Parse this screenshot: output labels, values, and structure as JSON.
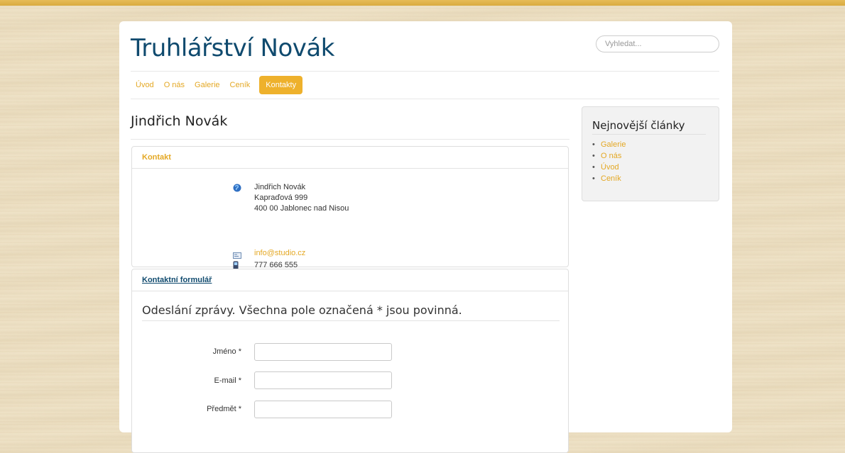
{
  "site": {
    "title": "Truhlářství Novák"
  },
  "search": {
    "placeholder": "Vyhledat..."
  },
  "nav": {
    "items": [
      "Úvod",
      "O nás",
      "Galerie",
      "Ceník",
      "Kontakty"
    ],
    "active": "Kontakty"
  },
  "page": {
    "heading": "Jindřich Novák"
  },
  "contact_panel": {
    "header": "Kontakt",
    "name": "Jindřich Novák",
    "street": "Kapraďová 999",
    "city": "400 00 Jablonec nad Nisou",
    "email": "info@studio.cz",
    "phone": "777 666 555"
  },
  "form_panel": {
    "header": "Kontaktní formulář",
    "title": "Odeslání zprávy. Všechna pole označená * jsou povinná.",
    "fields": [
      {
        "label": "Jméno *",
        "value": ""
      },
      {
        "label": "E-mail *",
        "value": ""
      },
      {
        "label": "Předmět *",
        "value": ""
      }
    ]
  },
  "sidebar": {
    "title": "Nejnovější články",
    "items": [
      "Galerie",
      "O nás",
      "Úvod",
      "Ceník"
    ]
  },
  "colors": {
    "accent": "#eeb12c",
    "link": "#e4a824",
    "title": "#0f4a6e"
  },
  "icons": {
    "address": "home-globe-icon",
    "email": "email-card-icon",
    "phone": "mobile-phone-icon"
  }
}
